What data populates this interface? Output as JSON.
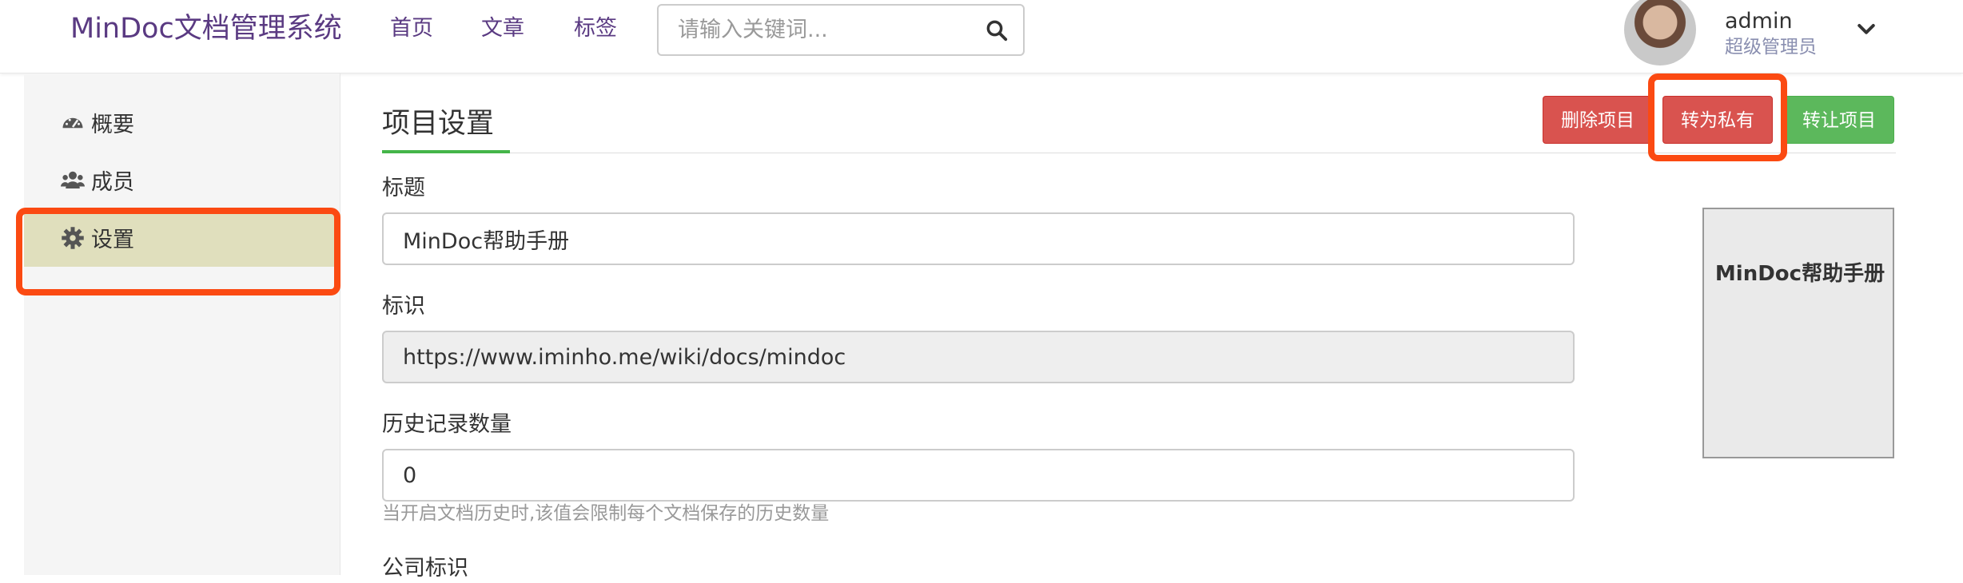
{
  "header": {
    "brand": "MinDoc文档管理系统",
    "nav": [
      "首页",
      "文章",
      "标签"
    ],
    "search_placeholder": "请输入关键词...",
    "user": {
      "name": "admin",
      "role": "超级管理员"
    }
  },
  "sidebar": {
    "items": [
      {
        "label": "概要",
        "icon": "dashboard-icon"
      },
      {
        "label": "成员",
        "icon": "users-icon"
      },
      {
        "label": "设置",
        "icon": "gear-icon"
      }
    ],
    "active_index": 2
  },
  "main": {
    "title": "项目设置",
    "buttons": {
      "delete": "删除项目",
      "private": "转为私有",
      "transfer": "转让项目"
    },
    "fields": {
      "title_label": "标题",
      "title_value": "MinDoc帮助手册",
      "ident_label": "标识",
      "ident_value": "https://www.iminho.me/wiki/docs/mindoc",
      "history_label": "历史记录数量",
      "history_value": "0",
      "history_help": "当开启文档历史时,该值会限制每个文档保存的历史数量",
      "company_label": "公司标识"
    },
    "cover_title": "MinDoc帮助手册"
  },
  "colors": {
    "brand": "#5a3a82",
    "active_bg": "#e0dfbd",
    "danger": "#d9534f",
    "success": "#5cb85c",
    "annotation": "#fb4a12",
    "tab_underline": "#44b549"
  }
}
